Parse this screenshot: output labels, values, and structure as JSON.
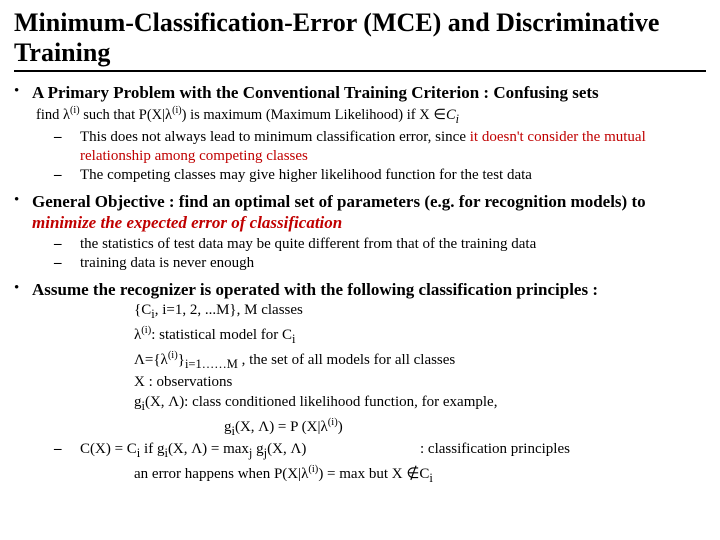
{
  "title": "Minimum-Classification-Error (MCE) and Discriminative Training",
  "p1_head": "A Primary Problem with the Conventional Training Criterion : Confusing sets",
  "p1_sub_a": "find λ",
  "p1_sub_b": " such that P(X|λ",
  "p1_sub_c": ") is maximum (Maximum Likelihood) if X ∈",
  "p1_sub_d": "C",
  "p1_sub_e": "i",
  "p1_d1_a": "This does not always lead to minimum classification error, since ",
  "p1_d1_b": "it doesn't consider the mutual relationship among competing classes",
  "p1_d2": "The competing classes may give higher likelihood function for the test data",
  "p2_a": "General Objective : find an optimal set of parameters (e.g. for recognition models) to ",
  "p2_b": "minimize the expected error of classification",
  "p2_d1": "the statistics of test data may be quite different from that of the training data",
  "p2_d2": "training data is never enough",
  "p3_head": "Assume the recognizer is operated with the following classification principles :",
  "def1_a": "{C",
  "def1_b": ", i=1, 2, ...M}, M classes",
  "def2_a": "λ",
  "def2_b": ": statistical model for C",
  "def3_a": "Λ={λ",
  "def3_b": "}",
  "def3_c": " , the set of all models for all classes",
  "def4": "X : observations",
  "def5_a": "g",
  "def5_b": "(X, Λ): class conditioned likelihood function, for example,",
  "def6_a": "g",
  "def6_b": "(X, Λ) = P (X|λ",
  "def6_c": ")",
  "cx_a": "C(X) = C",
  "cx_b": "   if g",
  "cx_c": "(X, Λ) = max",
  "cx_d": " g",
  "cx_e": "(X, Λ)",
  "cx_f": ": classification principles",
  "err_a": "an error happens when P(X|λ",
  "err_b": ") = max but X ∉C",
  "sup_i": "(i)",
  "sub_i": "i",
  "sub_j": "j",
  "sub_range": "i=1……M"
}
